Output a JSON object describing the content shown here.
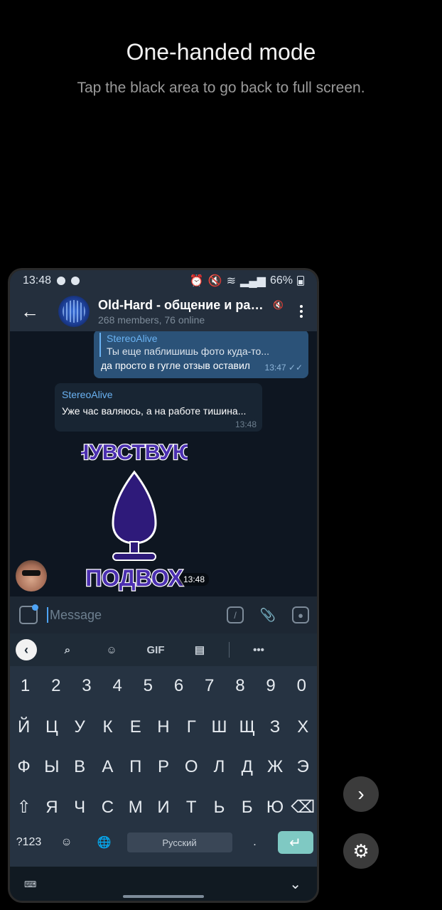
{
  "banner": {
    "title": "One-handed mode",
    "subtitle": "Tap the black area to go back to full screen."
  },
  "statusbar": {
    "time": "13:48",
    "battery": "66%"
  },
  "chat_header": {
    "title": "Old-Hard - общение и раз...",
    "subtitle": "268 members, 76 online"
  },
  "messages": {
    "outgoing": {
      "reply_name": "StereoAlive",
      "reply_text": "Ты еще паблишишь фото куда-то...",
      "text": "да просто в гугле отзыв оставил",
      "time": "13:47"
    },
    "incoming": {
      "name": "StereoAlive",
      "text": "Уже час валяюсь, а на работе тишина...",
      "time": "13:48"
    },
    "sticker": {
      "top_text": "ЧУВСТВУЮ",
      "bottom_text": "ПОДВОХ",
      "time": "13:48"
    }
  },
  "input": {
    "placeholder": "Message",
    "command_icon": "/"
  },
  "keyboard": {
    "toolbar": {
      "gif_label": "GIF",
      "more_label": "•••"
    },
    "row_numbers": [
      "1",
      "2",
      "3",
      "4",
      "5",
      "6",
      "7",
      "8",
      "9",
      "0"
    ],
    "row1": [
      "Й",
      "Ц",
      "У",
      "К",
      "Е",
      "Н",
      "Г",
      "Ш",
      "Щ",
      "З",
      "Х"
    ],
    "row2": [
      "Ф",
      "Ы",
      "В",
      "А",
      "П",
      "Р",
      "О",
      "Л",
      "Д",
      "Ж",
      "Э"
    ],
    "row3": [
      "Я",
      "Ч",
      "С",
      "М",
      "И",
      "Т",
      "Ь",
      "Б",
      "Ю"
    ],
    "symbols_label": "?123",
    "space_label": "Русский",
    "period_label": "."
  },
  "colors": {
    "accent": "#4ea4f6",
    "outgoing_bubble": "#2b5278",
    "incoming_bubble": "#182533",
    "sticker_purple": "#2e1a7a",
    "enter_key": "#7fc9c3"
  }
}
